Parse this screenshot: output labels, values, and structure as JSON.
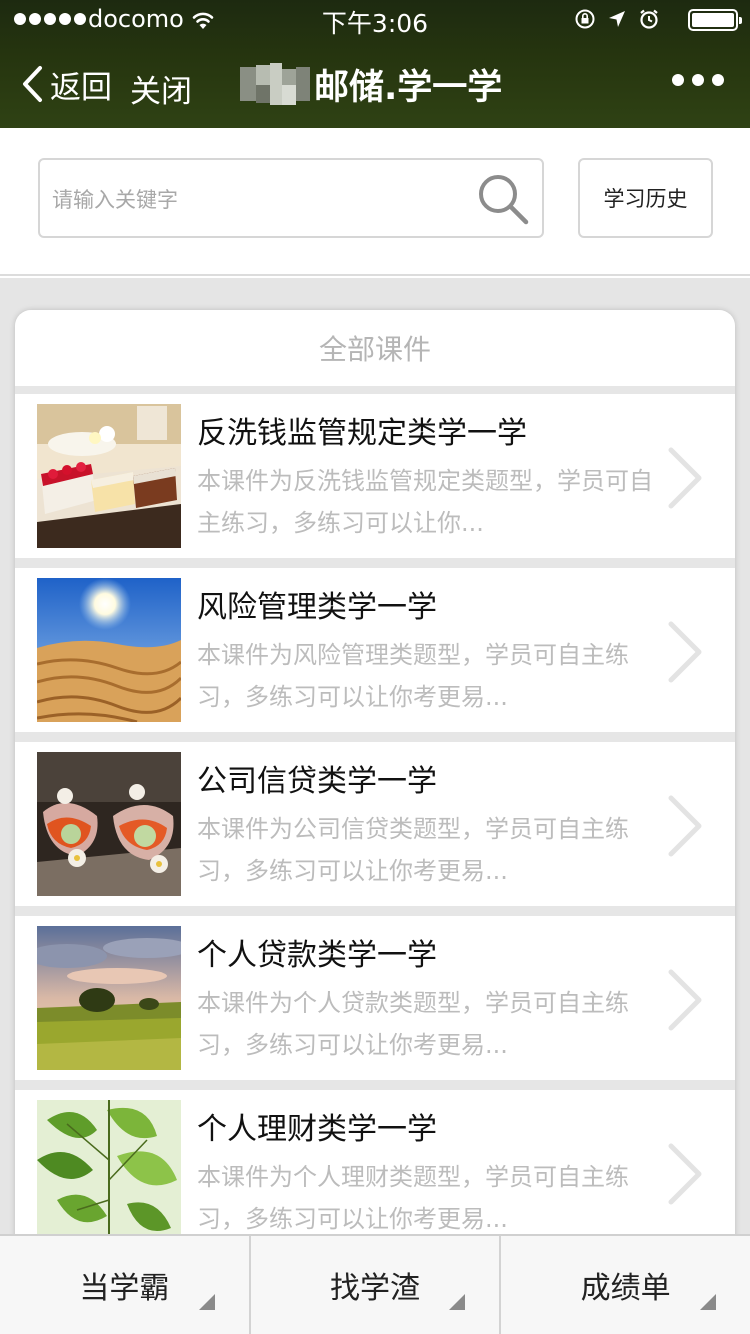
{
  "status_bar": {
    "carrier": "docomo",
    "time": "下午3:06",
    "icons": [
      "signal-dots-icon",
      "wifi-icon",
      "rotation-lock-icon",
      "location-arrow-icon",
      "alarm-icon",
      "battery-icon"
    ]
  },
  "nav": {
    "back_label": "返回",
    "close_label": "关闭",
    "title": "邮储.学一学",
    "more_icon": "more-dots-icon"
  },
  "search": {
    "placeholder": "请输入关键字",
    "value": "",
    "icon": "search-icon",
    "history_label": "学习历史"
  },
  "course_list": {
    "header": "全部课件",
    "items": [
      {
        "title": "反洗钱监管规定类学一学",
        "desc": "本课件为反洗钱监管规定类题型，学员可自主练习，多练习可以让你...",
        "thumb": "cakes-photo"
      },
      {
        "title": "风险管理类学一学",
        "desc": "本课件为风险管理类题型，学员可自主练习，多练习可以让你考更易...",
        "thumb": "desert-photo"
      },
      {
        "title": "公司信贷类学一学",
        "desc": "本课件为公司信贷类题型，学员可自主练习，多练习可以让你考更易...",
        "thumb": "sweets-photo"
      },
      {
        "title": "个人贷款类学一学",
        "desc": "本课件为个人贷款类题型，学员可自主练习，多练习可以让你考更易...",
        "thumb": "meadow-photo"
      },
      {
        "title": "个人理财类学一学",
        "desc": "本课件为个人理财类题型，学员可自主练习，多练习可以让你考更易...",
        "thumb": "leaves-photo"
      }
    ]
  },
  "tabbar": {
    "tabs": [
      {
        "label": "当学霸"
      },
      {
        "label": "找学渣"
      },
      {
        "label": "成绩单"
      }
    ]
  }
}
